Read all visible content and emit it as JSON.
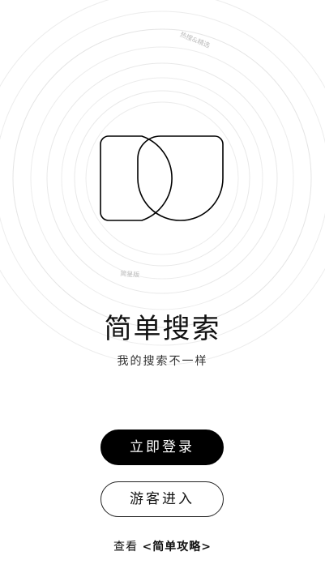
{
  "rings": {
    "top_label": "热搜&精选",
    "bottom_label": "简星版"
  },
  "brand": {
    "title": "简单搜索",
    "slogan": "我的搜索不一样"
  },
  "actions": {
    "login_label": "立即登录",
    "guest_label": "游客进入"
  },
  "guide": {
    "prefix": "查看 ",
    "link_label": "<简单攻略>"
  },
  "colors": {
    "primary": "#000000",
    "background": "#ffffff",
    "ring": "#e6e6e6"
  }
}
